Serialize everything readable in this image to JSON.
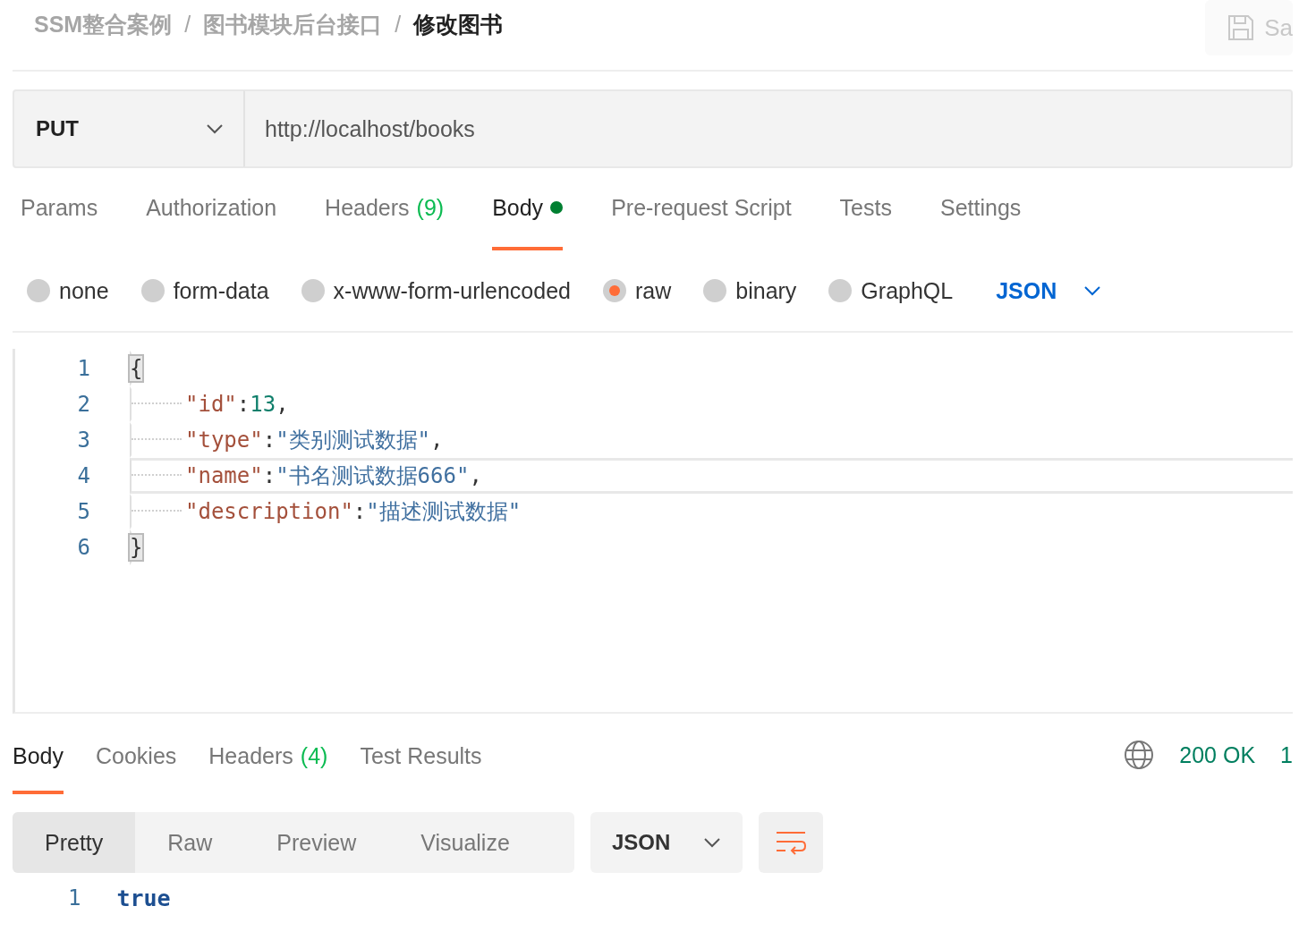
{
  "breadcrumb": [
    {
      "label": "SSM整合案例",
      "current": false
    },
    {
      "separator": "/",
      "label": "图书模块后台接口",
      "current": false
    },
    {
      "separator": "/",
      "label": "修改图书",
      "current": true
    }
  ],
  "save_button": {
    "label": "Sa"
  },
  "request": {
    "method": "PUT",
    "url": "http://localhost/books"
  },
  "request_tabs": [
    {
      "label": "Params",
      "selected": false,
      "has_content": false
    },
    {
      "label": "Authorization",
      "selected": false,
      "has_content": false
    },
    {
      "label": "Headers",
      "count": "(9)",
      "selected": false,
      "has_content": false
    },
    {
      "label": "Body",
      "selected": true,
      "has_content": true
    },
    {
      "label": "Pre-request Script",
      "selected": false,
      "has_content": false
    },
    {
      "label": "Tests",
      "selected": false,
      "has_content": false
    },
    {
      "label": "Settings",
      "selected": false,
      "has_content": false
    }
  ],
  "body_types": [
    {
      "label": "none",
      "selected": false
    },
    {
      "label": "form-data",
      "selected": false
    },
    {
      "label": "x-www-form-urlencoded",
      "selected": false
    },
    {
      "label": "raw",
      "selected": true
    },
    {
      "label": "binary",
      "selected": false
    },
    {
      "label": "GraphQL",
      "selected": false
    }
  ],
  "raw_format": "JSON",
  "editor_lines": [
    {
      "number": "1",
      "active": false,
      "indented": false,
      "tokens": [
        {
          "kind": "bracket_match",
          "text": "{"
        }
      ]
    },
    {
      "number": "2",
      "active": false,
      "indented": true,
      "tokens": [
        {
          "kind": "key",
          "text": "\"id\""
        },
        {
          "kind": "punct",
          "text": ":"
        },
        {
          "kind": "number",
          "text": "13"
        },
        {
          "kind": "punct",
          "text": ","
        }
      ]
    },
    {
      "number": "3",
      "active": false,
      "indented": true,
      "tokens": [
        {
          "kind": "key",
          "text": "\"type\""
        },
        {
          "kind": "punct",
          "text": ":"
        },
        {
          "kind": "string",
          "text": "\"类别测试数据\""
        },
        {
          "kind": "punct",
          "text": ","
        }
      ]
    },
    {
      "number": "4",
      "active": true,
      "indented": true,
      "tokens": [
        {
          "kind": "key",
          "text": "\"name\""
        },
        {
          "kind": "punct",
          "text": ":"
        },
        {
          "kind": "string",
          "text": "\"书名测试数据666\""
        },
        {
          "kind": "punct",
          "text": ","
        }
      ]
    },
    {
      "number": "5",
      "active": false,
      "indented": true,
      "tokens": [
        {
          "kind": "key",
          "text": "\"description\""
        },
        {
          "kind": "punct",
          "text": ":"
        },
        {
          "kind": "string",
          "text": "\"描述测试数据\""
        }
      ]
    },
    {
      "number": "6",
      "active": false,
      "indented": false,
      "tokens": [
        {
          "kind": "bracket_match",
          "text": "}"
        }
      ]
    }
  ],
  "response_tabs": [
    {
      "label": "Body",
      "selected": true
    },
    {
      "label": "Cookies",
      "selected": false
    },
    {
      "label": "Headers",
      "count": "(4)",
      "selected": false
    },
    {
      "label": "Test Results",
      "selected": false
    }
  ],
  "status": {
    "code": "200 OK",
    "next": "1"
  },
  "view_modes": [
    {
      "label": "Pretty",
      "selected": true
    },
    {
      "label": "Raw",
      "selected": false
    },
    {
      "label": "Preview",
      "selected": false
    },
    {
      "label": "Visualize",
      "selected": false
    }
  ],
  "response_format": "JSON",
  "response_lines": [
    {
      "number": "1",
      "text": "true"
    }
  ]
}
